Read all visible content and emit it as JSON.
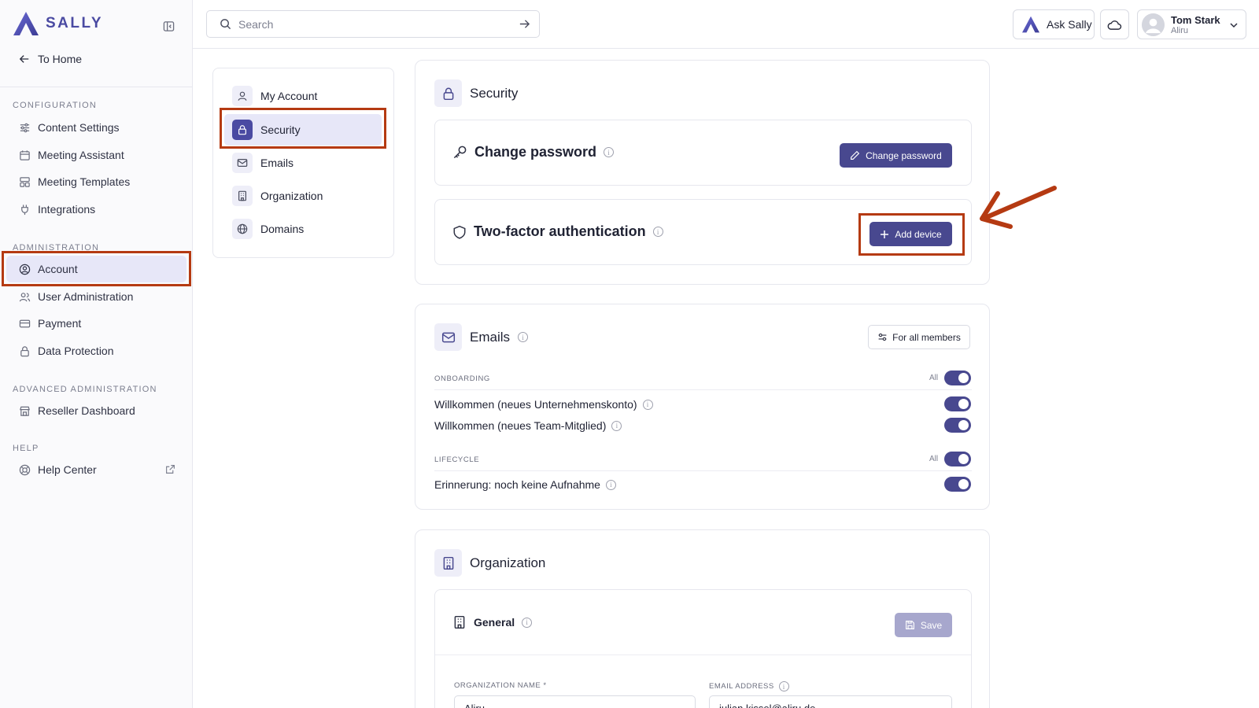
{
  "brand": {
    "name": "SALLY",
    "accent": "#4a4aa2",
    "highlight": "#b53a12"
  },
  "sidebar": {
    "to_home": "To Home",
    "sections": [
      {
        "title": "CONFIGURATION",
        "items": [
          "Content Settings",
          "Meeting Assistant",
          "Meeting Templates",
          "Integrations"
        ]
      },
      {
        "title": "ADMINISTRATION",
        "items": [
          "Account",
          "User Administration",
          "Payment",
          "Data Protection"
        ]
      },
      {
        "title": "ADVANCED ADMINISTRATION",
        "items": [
          "Reseller Dashboard"
        ]
      },
      {
        "title": "HELP",
        "items": [
          "Help Center"
        ]
      }
    ],
    "active_item": "Account"
  },
  "topbar": {
    "search_placeholder": "Search",
    "ask_label": "Ask Sally",
    "user_name": "Tom Stark",
    "user_org": "Aliru"
  },
  "settings_nav": {
    "items": [
      "My Account",
      "Security",
      "Emails",
      "Organization",
      "Domains"
    ],
    "active_item": "Security"
  },
  "security": {
    "title": "Security",
    "change_password_title": "Change password",
    "change_password_button": "Change password",
    "twofa_title": "Two-factor authentication",
    "add_device_button": "Add device"
  },
  "emails": {
    "title": "Emails",
    "for_all_button": "For all members",
    "all_label": "All",
    "groups": [
      {
        "label": "ONBOARDING",
        "rows": [
          "Willkommen (neues Unternehmenskonto)",
          "Willkommen (neues Team-Mitglied)"
        ]
      },
      {
        "label": "LIFECYCLE",
        "rows": [
          "Erinnerung: noch keine Aufnahme"
        ]
      }
    ]
  },
  "organization": {
    "title": "Organization",
    "general_title": "General",
    "save_button": "Save",
    "name_label": "ORGANIZATION NAME *",
    "name_value": "Aliru",
    "email_label": "EMAIL ADDRESS",
    "email_value": "julian.kissel@aliru.de"
  }
}
